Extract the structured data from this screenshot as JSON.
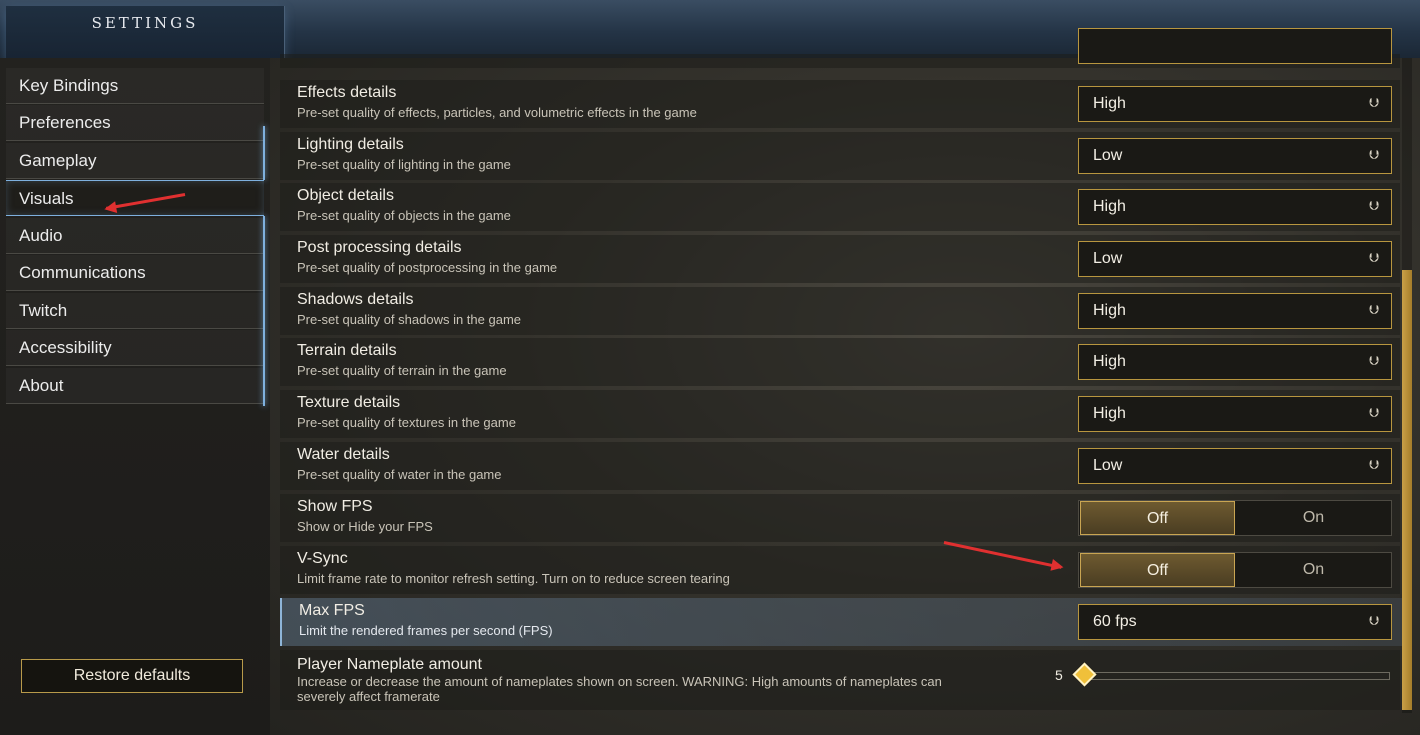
{
  "header": {
    "title": "SETTINGS"
  },
  "sidebar": {
    "items": [
      {
        "label": "Key Bindings"
      },
      {
        "label": "Preferences"
      },
      {
        "label": "Gameplay"
      },
      {
        "label": "Visuals"
      },
      {
        "label": "Audio"
      },
      {
        "label": "Communications"
      },
      {
        "label": "Twitch"
      },
      {
        "label": "Accessibility"
      },
      {
        "label": "About"
      }
    ],
    "restore_label": "Restore defaults"
  },
  "settings": [
    {
      "title": "Effects details",
      "desc": "Pre-set quality of effects, particles, and volumetric effects in the game",
      "value": "High"
    },
    {
      "title": "Lighting details",
      "desc": "Pre-set quality of lighting in the game",
      "value": "Low"
    },
    {
      "title": "Object details",
      "desc": "Pre-set quality of objects in the game",
      "value": "High"
    },
    {
      "title": "Post processing details",
      "desc": "Pre-set quality of postprocessing in the game",
      "value": "Low"
    },
    {
      "title": "Shadows details",
      "desc": "Pre-set quality of shadows in the game",
      "value": "High"
    },
    {
      "title": "Terrain details",
      "desc": "Pre-set quality of terrain in the game",
      "value": "High"
    },
    {
      "title": "Texture details",
      "desc": "Pre-set quality of textures in the game",
      "value": "High"
    },
    {
      "title": "Water details",
      "desc": "Pre-set quality of water in the game",
      "value": "Low"
    },
    {
      "title": "Show FPS",
      "desc": "Show or Hide your FPS",
      "off": "Off",
      "on": "On"
    },
    {
      "title": "V-Sync",
      "desc": "Limit frame rate to monitor refresh setting. Turn on to reduce screen tearing",
      "off": "Off",
      "on": "On"
    },
    {
      "title": "Max FPS",
      "desc": "Limit the rendered frames per second (FPS)",
      "value": "60 fps"
    },
    {
      "title": "Player Nameplate amount",
      "desc": "Increase or decrease the amount of nameplates shown on screen. WARNING: High amounts of nameplates can severely affect framerate",
      "value": "5"
    }
  ],
  "icons": {
    "dropdown": "chevron-down-icon",
    "slider": "diamond-knob-icon",
    "annotation": "red-arrow-icon"
  },
  "colors": {
    "accent_gold": "#b8963f",
    "accent_blue": "#7eb0de",
    "annotation_red": "#e03030"
  }
}
